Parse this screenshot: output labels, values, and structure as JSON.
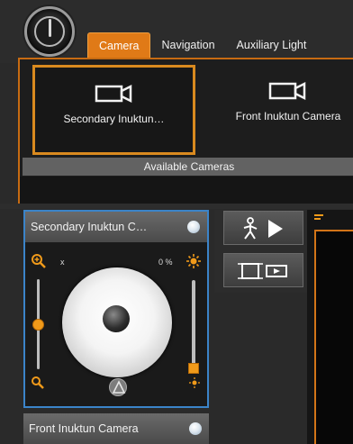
{
  "tabs": [
    {
      "label": "Camera",
      "active": true
    },
    {
      "label": "Navigation",
      "active": false
    },
    {
      "label": "Auxiliary Light",
      "active": false
    }
  ],
  "available_cameras": {
    "title": "Available Cameras",
    "cards": [
      {
        "label": "Secondary Inuktun…",
        "selected": true
      },
      {
        "label": "Front Inuktun Camera",
        "selected": false
      }
    ]
  },
  "camera_panels": [
    {
      "title": "Secondary Inuktun C…",
      "zoom_label": "x",
      "light_label": "0 %",
      "zoom_level": 0.5,
      "light_level": 0.0
    },
    {
      "title": "Front Inuktun Camera"
    }
  ],
  "colors": {
    "accent_orange": "#e07a17",
    "selection_blue": "#3b84c9",
    "panel_dark": "#1a1a1a"
  },
  "icons": {
    "power": "power-icon",
    "camera": "video-camera-icon",
    "zoom_in": "zoom-in-icon",
    "zoom_out": "zoom-out-icon",
    "light_high": "brightness-high-icon",
    "light_low": "brightness-low-icon",
    "walk_play": "walk-play-icon",
    "film_strip": "film-strip-icon",
    "home": "home-icon"
  }
}
